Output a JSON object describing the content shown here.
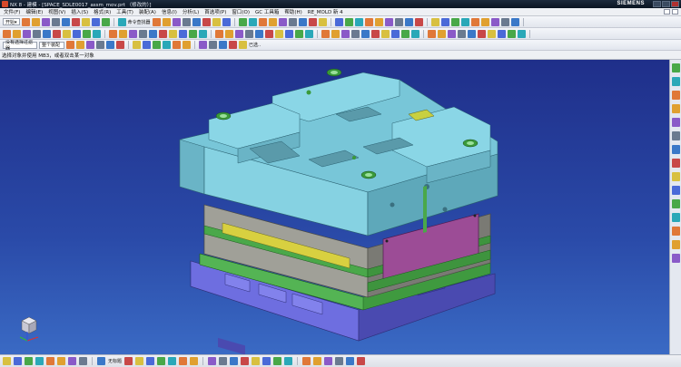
{
  "window": {
    "title": "NX 8 - 建模 - [SPACE_SDLE0017_assm_mov.prt （修改的）]",
    "brand": "SIEMENS"
  },
  "menu": [
    "文件(F)",
    "编辑(E)",
    "视图(V)",
    "插入(S)",
    "格式(R)",
    "工具(T)",
    "装配(A)",
    "信息(I)",
    "分析(L)",
    "首选项(P)",
    "窗口(O)",
    "GC 工具箱",
    "帮助(H)",
    "RE_MOLD 新 4"
  ],
  "toolbar": {
    "start_label": "开始▾",
    "command_finder_label": "命令查找器",
    "filter_label": "没有选择过滤器",
    "assembly_label": "整个装配",
    "extra_label": "已选.."
  },
  "status": {
    "prompt": "选择对象并使用 MB3，或者双击某一对象"
  },
  "bottom": {
    "label": "无标题"
  },
  "colors": {
    "viewport_top": "#1f2f8a",
    "viewport_bottom": "#3a6ac4",
    "top_plate": "#7ecfe0",
    "mid_plate": "#8a8c8c",
    "green_plate": "#4aa84a",
    "base_plate": "#6a6ad8",
    "insert": "#9a4a90"
  },
  "icons": {
    "toolbar1": [
      "new-icon",
      "open-icon",
      "save-icon",
      "cut-icon",
      "copy-icon",
      "paste-icon",
      "delete-icon",
      "undo-icon",
      "redo-icon",
      "command-finder-icon",
      "window-icon",
      "fit-icon",
      "zoom-icon",
      "rotate-icon",
      "pan-icon",
      "shaded-icon",
      "wireframe-icon",
      "layer-icon",
      "render-icon",
      "view-icon",
      "measure-icon",
      "analysis-icon",
      "color-icon",
      "snap-icon",
      "point-icon",
      "line-icon",
      "circle-icon",
      "arc-icon",
      "spline-icon",
      "plane-icon",
      "csys-icon",
      "sketch-icon",
      "extrude-icon",
      "revolve-icon",
      "hole-icon",
      "blend-icon",
      "chamfer-icon",
      "shell-icon",
      "trim-icon",
      "pattern-icon",
      "mirror-icon",
      "unite-icon",
      "subtract-icon",
      "intersect-icon",
      "help-icon"
    ],
    "toolbar2": [
      "mold-wizard-icon",
      "project-icon",
      "part-icon",
      "csys-icon",
      "shrink-icon",
      "workpiece-icon",
      "layout-icon",
      "family-icon",
      "tool-icon",
      "parting-icon",
      "moldbase-icon",
      "standard-icon",
      "ejector-icon",
      "slider-icon",
      "lifter-icon",
      "gate-icon",
      "runner-icon",
      "cooling-icon",
      "electrode-icon",
      "trim-icon",
      "pocket-icon",
      "bom-icon",
      "drawing-icon",
      "hole-table-icon",
      "cost-icon",
      "check-icon",
      "view-icon",
      "delete-icon",
      "assembly-icon",
      "constraint-icon",
      "explode-icon",
      "component-icon",
      "replace-icon",
      "move-icon",
      "array-icon",
      "mirror-icon",
      "wave-icon",
      "reference-icon",
      "clearance-icon",
      "sequence-icon",
      "product-icon",
      "weight-icon",
      "report-icon",
      "export-icon",
      "import-icon",
      "print-icon",
      "plot-icon",
      "mail-icon",
      "refresh-icon",
      "settings-icon"
    ],
    "toolbar3": [
      "select-icon",
      "feature-icon",
      "face-icon",
      "body-icon",
      "edge-icon",
      "curve-icon",
      "point-icon",
      "snap-end-icon",
      "snap-mid-icon",
      "snap-center-icon",
      "snap-quad-icon",
      "snap-point-icon",
      "snap-intersect-icon",
      "snap-arc-icon",
      "snap-existing-icon",
      "grid-icon",
      "select-all-icon"
    ],
    "resource_bar": [
      "assembly-navigator-icon",
      "constraint-navigator-icon",
      "part-navigator-icon",
      "reuse-library-icon",
      "hd3d-icon",
      "web-browser-icon",
      "history-icon",
      "system-materials-icon",
      "process-studio-icon",
      "roles-icon",
      "system-scene-icon",
      "mold-wizard-icon",
      "manufacturing-icon",
      "scene-icon",
      "palette-icon"
    ],
    "bottom": [
      "select-icon",
      "wcs-icon",
      "snap-icon",
      "point-icon",
      "line-icon",
      "arc-icon",
      "circle-icon",
      "rectangle-icon",
      "polygon-icon",
      "spline-icon",
      "offset-icon",
      "fillet-icon",
      "chamfer-icon",
      "trim-icon",
      "extend-icon",
      "mirror-icon",
      "pattern-icon",
      "constraint-icon",
      "dimension-icon",
      "note-icon",
      "measure-icon",
      "analysis-icon",
      "view-icon",
      "layer-icon",
      "color-icon",
      "hide-icon",
      "show-icon",
      "move-icon",
      "rotate-icon",
      "help-icon"
    ]
  }
}
